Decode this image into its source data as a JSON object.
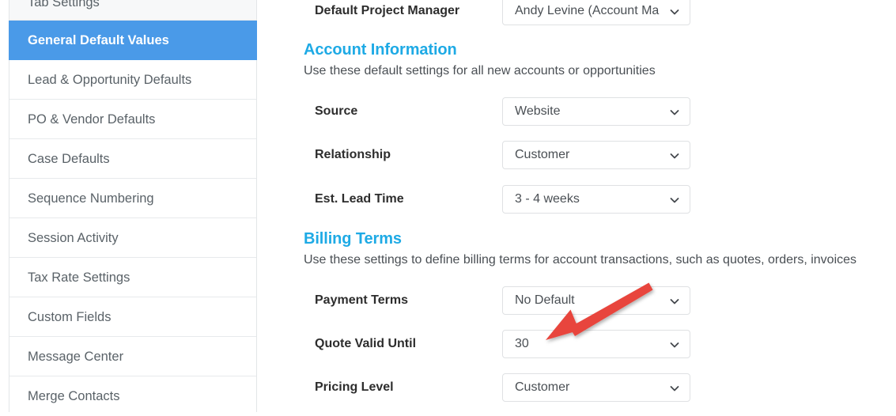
{
  "colors": {
    "sidebar_active_bg": "#4a9ae8",
    "section_heading": "#1eaae5",
    "annotation_arrow": "#e8453c",
    "select_border": "#dfe1e3",
    "label_text": "#2d2d2d"
  },
  "sidebar": {
    "items": [
      {
        "label": "Tab Settings",
        "state": "hovered"
      },
      {
        "label": "General Default Values",
        "state": "active"
      },
      {
        "label": "Lead & Opportunity Defaults",
        "state": "normal"
      },
      {
        "label": "PO & Vendor Defaults",
        "state": "normal"
      },
      {
        "label": "Case Defaults",
        "state": "normal"
      },
      {
        "label": "Sequence Numbering",
        "state": "normal"
      },
      {
        "label": "Session Activity",
        "state": "normal"
      },
      {
        "label": "Tax Rate Settings",
        "state": "normal"
      },
      {
        "label": "Custom Fields",
        "state": "normal"
      },
      {
        "label": "Message Center",
        "state": "normal"
      },
      {
        "label": "Merge Contacts",
        "state": "normal"
      }
    ]
  },
  "main": {
    "top_field": {
      "label": "Default Project Manager",
      "value": "Andy Levine (Account Ma"
    },
    "sections": [
      {
        "heading": "Account Information",
        "subtitle": "Use these default settings for all new accounts or opportunities",
        "fields": [
          {
            "label": "Source",
            "value": "Website"
          },
          {
            "label": "Relationship",
            "value": "Customer"
          },
          {
            "label": "Est. Lead Time",
            "value": "3 - 4 weeks"
          }
        ]
      },
      {
        "heading": "Billing Terms",
        "subtitle": "Use these settings to define billing terms for account transactions, such as quotes, orders, invoices",
        "fields": [
          {
            "label": "Payment Terms",
            "value": "No Default"
          },
          {
            "label": "Quote Valid Until",
            "value": "30"
          },
          {
            "label": "Pricing Level",
            "value": "Customer"
          }
        ]
      }
    ]
  },
  "annotation": {
    "name": "red-arrow-pointing-to-quote-valid-until",
    "points_at": "Quote Valid Until"
  }
}
